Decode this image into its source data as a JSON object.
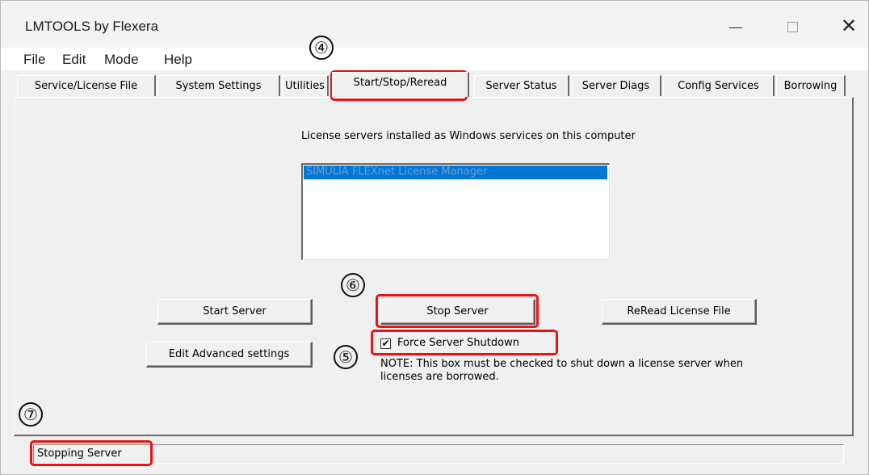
{
  "window": {
    "title": "LMTOOLS by Flexera"
  },
  "menu": [
    "File",
    "Edit",
    "Mode",
    "Help"
  ],
  "tabs": [
    {
      "label": "Service/License File"
    },
    {
      "label": "System Settings"
    },
    {
      "label": "Utilities"
    },
    {
      "label": "Start/Stop/Reread",
      "active": true
    },
    {
      "label": "Server Status"
    },
    {
      "label": "Server Diags"
    },
    {
      "label": "Config Services"
    },
    {
      "label": "Borrowing"
    }
  ],
  "panel": {
    "services_label": "License servers installed as Windows services on this computer",
    "services_list": [
      "SIMULIA FLEXnet License Manager"
    ],
    "selected_service_index": 0,
    "buttons": {
      "start": "Start Server",
      "stop": "Stop Server",
      "reread": "ReRead License File",
      "advanced": "Edit Advanced settings"
    },
    "force_shutdown": {
      "label": "Force Server Shutdown",
      "checked": true
    },
    "note": "NOTE:  This box must be checked to shut down a license server when licenses are borrowed."
  },
  "status": {
    "text": "Stopping Server"
  },
  "annotations": {
    "m4": "④",
    "m5": "⑤",
    "m6": "⑥",
    "m7": "⑦"
  },
  "colors": {
    "callout": "#ee1111",
    "selection": "#0078d7"
  }
}
